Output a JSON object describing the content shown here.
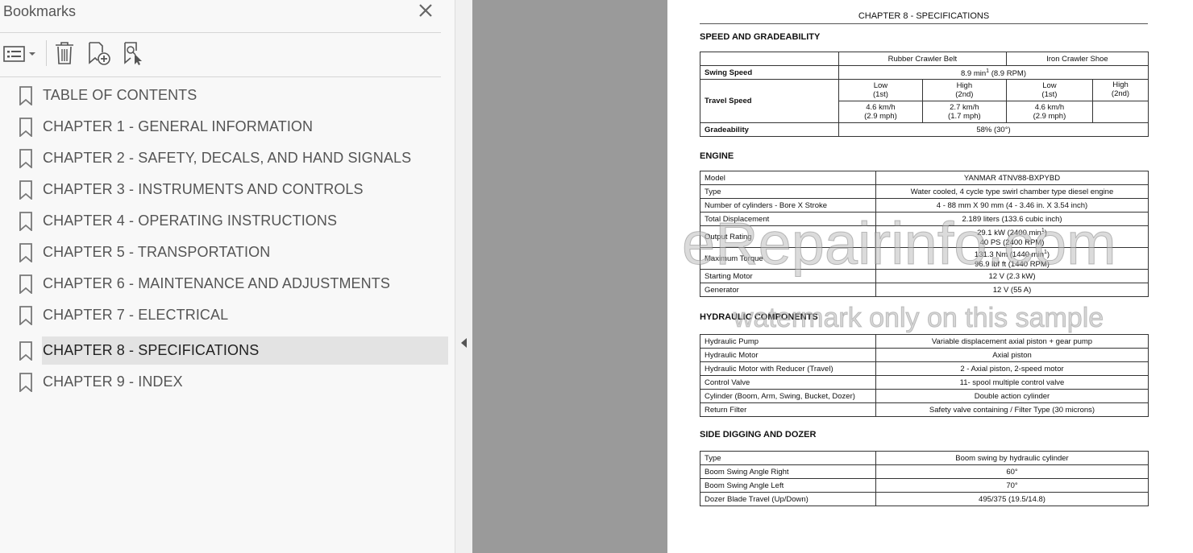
{
  "bookmarks_panel": {
    "title": "Bookmarks",
    "items": [
      {
        "label": "TABLE OF CONTENTS"
      },
      {
        "label": "CHAPTER 1 - GENERAL INFORMATION"
      },
      {
        "label": "CHAPTER 2 - SAFETY, DECALS, AND HAND SIGNALS"
      },
      {
        "label": "CHAPTER 3 - INSTRUMENTS AND CONTROLS"
      },
      {
        "label": "CHAPTER 4 - OPERATING INSTRUCTIONS"
      },
      {
        "label": "CHAPTER 5 - TRANSPORTATION"
      },
      {
        "label": "CHAPTER 6 - MAINTENANCE AND ADJUSTMENTS"
      },
      {
        "label": "CHAPTER 7 - ELECTRICAL"
      },
      {
        "label": "CHAPTER 8 - SPECIFICATIONS",
        "selected": true
      },
      {
        "label": "CHAPTER 9 - INDEX"
      }
    ]
  },
  "document": {
    "chapter_title": "CHAPTER 8 - SPECIFICATIONS",
    "speed": {
      "heading": "SPEED AND GRADEABILITY",
      "col_rubber": "Rubber Crawler Belt",
      "col_iron": "Iron Crawler Shoe",
      "swing_label": "Swing Speed",
      "swing_value": "8.9 min",
      "swing_sup": "1",
      "swing_rest": " (8.9 RPM)",
      "travel_label": "Travel Speed",
      "low_1": "Low",
      "first_1": "(1st)",
      "high_1": "High",
      "second_1": "(2nd)",
      "low_2": "Low",
      "first_2": "(1st)",
      "high_2": "High",
      "second_2": "(2nd)",
      "t1a": "4.6 km/h",
      "t1b": "(2.9 mph)",
      "t2a": "2.7 km/h",
      "t2b": "(1.7 mph)",
      "t3a": "4.6 km/h",
      "t3b": "(2.9 mph)",
      "grade_label": "Gradeability",
      "grade_value": "58% (30°)"
    },
    "engine": {
      "heading": "ENGINE",
      "model_label": "Model",
      "model_value": "YANMAR 4TNV88-BXPYBD",
      "type_label": "Type",
      "type_value": "Water cooled, 4 cycle type swirl chamber type diesel engine",
      "cyl_label": "Number of cylinders - Bore X Stroke",
      "cyl_value": "4 - 88 mm X 90 mm (4 - 3.46 in. X 3.54 inch)",
      "disp_label": "Total Displacement",
      "disp_value": "2.189 liters (133.6 cubic inch)",
      "out_label": "Output Rating",
      "out_value1": "29.1 kW (2400 min",
      "out_sup": "1",
      "out_value1_end": ")",
      "out_value2": "40 PS (2400 RPM)",
      "torque_label": "Maximum Torque",
      "torque_value1": "131.3 Nm (1440 min",
      "torque_sup": "1",
      "torque_value1_end": ")",
      "torque_value2": "96.9 lbf ft (1440 RPM)",
      "starter_label": "Starting Motor",
      "starter_value": "12 V (2.3 kW)",
      "gen_label": "Generator",
      "gen_value": "12 V (55 A)"
    },
    "hydraulic": {
      "heading": "HYDRAULIC COMPONENTS",
      "rows": [
        {
          "label": "Hydraulic Pump",
          "value": "Variable displacement axial piston + gear pump"
        },
        {
          "label": "Hydraulic Motor",
          "value": "Axial piston"
        },
        {
          "label": "Hydraulic Motor with Reducer (Travel)",
          "value": "2 - Axial piston, 2-speed motor"
        },
        {
          "label": "Control Valve",
          "value": "11- spool multiple control valve"
        },
        {
          "label": "Cylinder (Boom, Arm, Swing, Bucket, Dozer)",
          "value": "Double action cylinder"
        },
        {
          "label": "Return Filter",
          "value": "Safety valve containing / Filter Type (30 microns)"
        }
      ]
    },
    "side": {
      "heading": "SIDE DIGGING AND DOZER",
      "rows": [
        {
          "label": "Type",
          "value": "Boom swing by hydraulic cylinder"
        },
        {
          "label": "Boom Swing Angle Right",
          "value": "60°"
        },
        {
          "label": "Boom Swing Angle Left",
          "value": "70°"
        },
        {
          "label": "Dozer Blade Travel (Up/Down)",
          "value": "495/375 (19.5/14.8)"
        }
      ]
    }
  },
  "watermark": {
    "line1": "eRepairinfo.com",
    "line2": "watermark only on this sample"
  }
}
